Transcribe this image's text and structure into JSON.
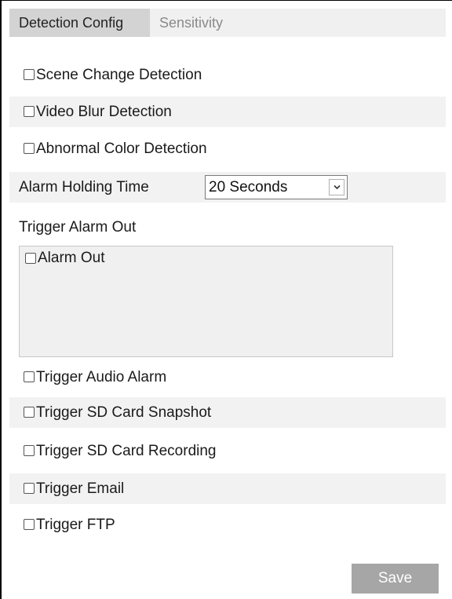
{
  "tabs": [
    {
      "label": "Detection Config",
      "active": true
    },
    {
      "label": "Sensitivity",
      "active": false
    }
  ],
  "detection": {
    "scene_change": {
      "label": "Scene Change Detection",
      "checked": false
    },
    "video_blur": {
      "label": "Video Blur Detection",
      "checked": false
    },
    "abnormal_color": {
      "label": "Abnormal Color Detection",
      "checked": false
    }
  },
  "alarm_holding": {
    "label": "Alarm Holding Time",
    "value": "20 Seconds"
  },
  "trigger_alarm_out": {
    "label": "Trigger Alarm Out",
    "alarm_out": {
      "label": "Alarm Out",
      "checked": false
    }
  },
  "triggers": {
    "audio": {
      "label": "Trigger Audio Alarm",
      "checked": false
    },
    "sd_snapshot": {
      "label": "Trigger SD Card Snapshot",
      "checked": false
    },
    "sd_recording": {
      "label": "Trigger SD Card Recording",
      "checked": false
    },
    "email": {
      "label": "Trigger Email",
      "checked": false
    },
    "ftp": {
      "label": "Trigger FTP",
      "checked": false
    }
  },
  "save_label": "Save",
  "colors": {
    "tab_active_bg": "#d3d3d3",
    "tab_bar_bg": "#f0f0f0",
    "row_shade": "#f2f2f2",
    "save_bg": "#a6a6a6",
    "inactive_tab_text": "#8a8a8a"
  }
}
